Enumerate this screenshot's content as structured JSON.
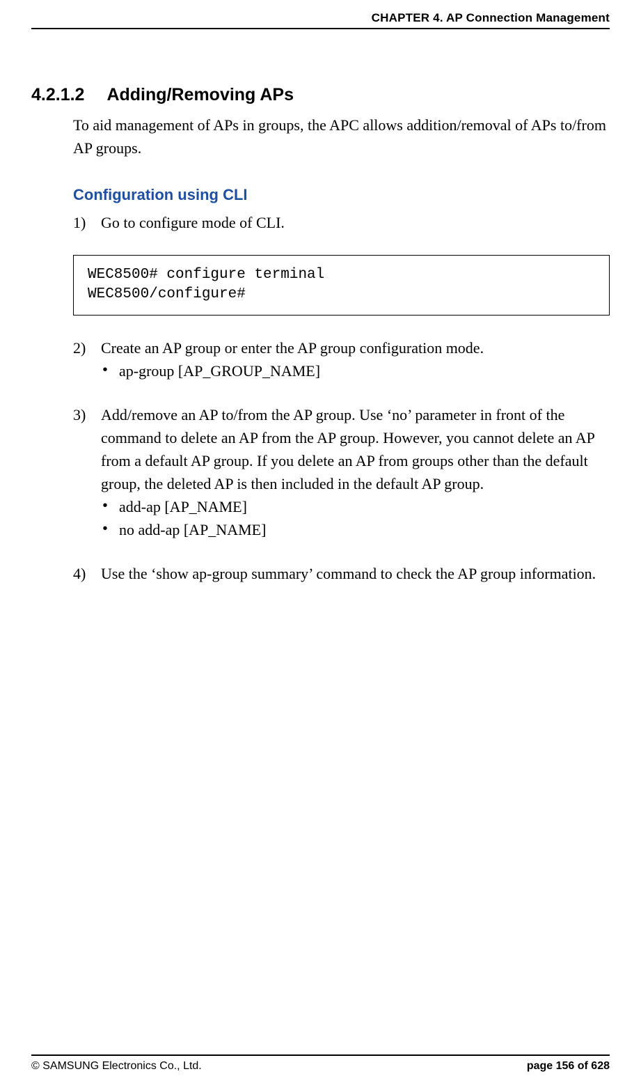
{
  "header": {
    "chapter": "CHAPTER 4. AP Connection Management"
  },
  "section": {
    "number": "4.2.1.2",
    "title": "Adding/Removing APs",
    "intro": "To aid management of APs in groups, the APC allows addition/removal of APs to/from AP groups."
  },
  "subheading": "Configuration using CLI",
  "steps": {
    "s1": {
      "num": "1)",
      "text": "Go to configure mode of CLI."
    },
    "s2": {
      "num": "2)",
      "text": "Create an AP group or enter the AP group configuration mode.",
      "b1": "ap-group [AP_GROUP_NAME]"
    },
    "s3": {
      "num": "3)",
      "text": "Add/remove an AP to/from the AP group. Use ‘no’ parameter in front of the command to delete an AP from the AP group. However, you cannot delete an AP from a default AP group. If you delete an AP from groups other than the default group, the deleted AP is then included in the default AP group.",
      "b1": "add-ap [AP_NAME]",
      "b2": "no add-ap [AP_NAME]"
    },
    "s4": {
      "num": "4)",
      "text": "Use the ‘show ap-group summary’ command to check the AP group information."
    }
  },
  "codebox": "WEC8500# configure terminal\nWEC8500/configure#",
  "footer": {
    "left": "© SAMSUNG Electronics Co., Ltd.",
    "right": "page 156 of 628"
  }
}
